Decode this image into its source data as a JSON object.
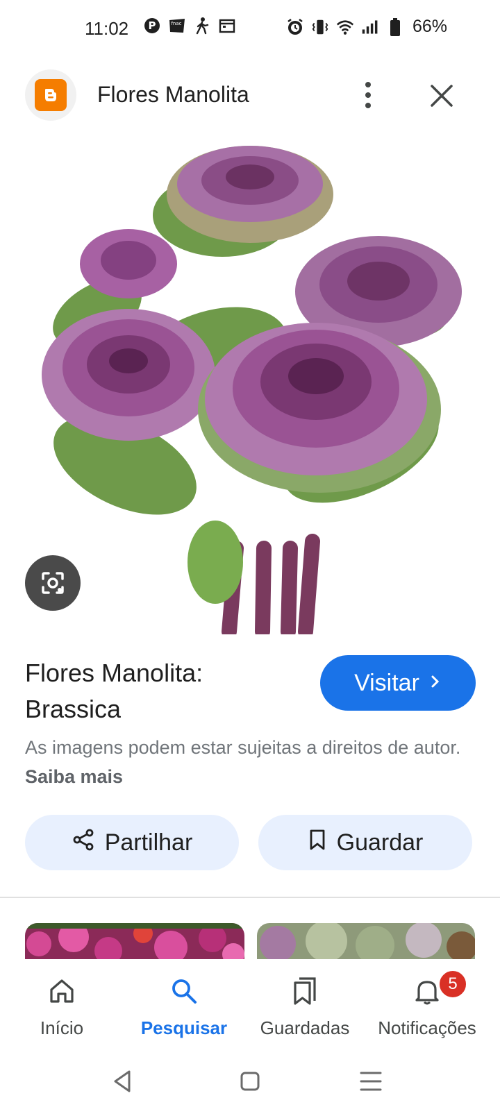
{
  "status_bar": {
    "time": "11:02",
    "battery": "66%",
    "left_icons": [
      "pinterest-icon",
      "fnac-icon",
      "walk-icon",
      "calendar-icon"
    ],
    "right_icons": [
      "alarm-icon",
      "vibrate-icon",
      "wifi-icon",
      "signal-icon",
      "battery-icon"
    ]
  },
  "header": {
    "site_name": "Flores Manolita",
    "logo": "blogger-icon"
  },
  "result": {
    "title_line1": "Flores Manolita:",
    "title_line2": "Brassica",
    "visit_label": "Visitar",
    "notice_text": "As imagens podem estar sujeitas a direitos de autor.",
    "notice_link": "Saiba mais",
    "share_label": "Partilhar",
    "save_label": "Guardar"
  },
  "bottom_nav": {
    "items": [
      {
        "label": "Início",
        "icon": "home-icon"
      },
      {
        "label": "Pesquisar",
        "icon": "search-icon"
      },
      {
        "label": "Guardadas",
        "icon": "bookmarks-icon"
      },
      {
        "label": "Notificações",
        "icon": "bell-icon"
      }
    ],
    "active": "Pesquisar",
    "notification_count": "5"
  },
  "colors": {
    "accent": "#1a73e8",
    "chip_bg": "#e8f0fe",
    "blogger": "#f57d00",
    "badge": "#d93025"
  }
}
